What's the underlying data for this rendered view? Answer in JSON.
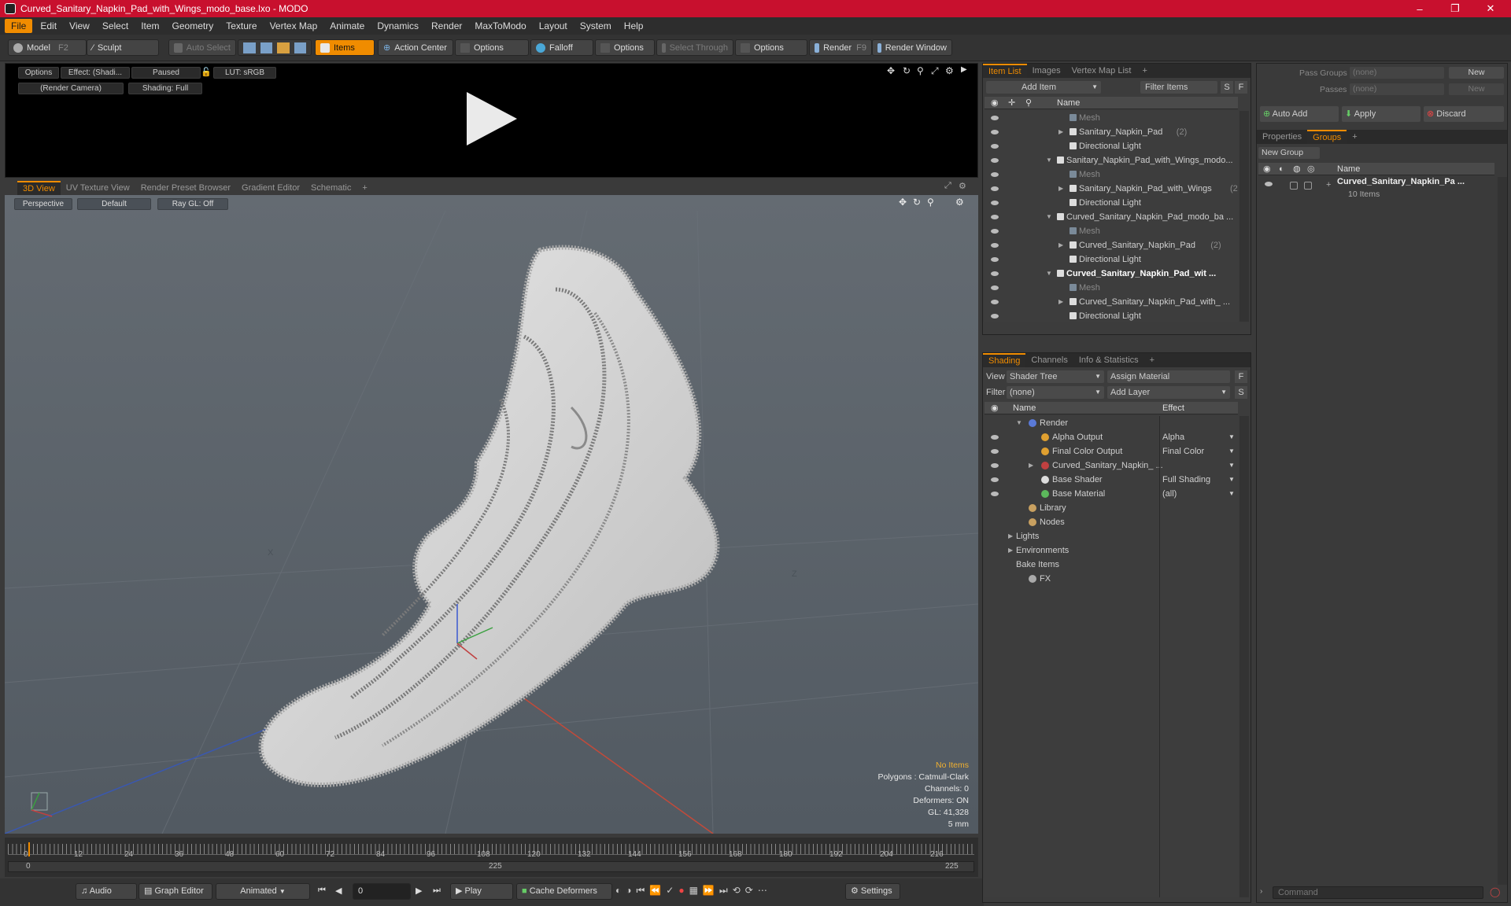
{
  "window": {
    "title": "Curved_Sanitary_Napkin_Pad_with_Wings_modo_base.lxo - MODO"
  },
  "menu": [
    "File",
    "Edit",
    "View",
    "Select",
    "Item",
    "Geometry",
    "Texture",
    "Vertex Map",
    "Animate",
    "Dynamics",
    "Render",
    "MaxToModo",
    "Layout",
    "System",
    "Help"
  ],
  "toolbar": {
    "model": "Model",
    "model_hk": "F2",
    "sculpt": "Sculpt",
    "auto_select": "Auto Select",
    "items": "Items",
    "action_center": "Action Center",
    "options1": "Options",
    "falloff": "Falloff",
    "options2": "Options",
    "select_through": "Select Through",
    "options3": "Options",
    "render": "Render",
    "render_hk": "F9",
    "render_window": "Render Window"
  },
  "preview": {
    "options": "Options",
    "effect": "Effect: (Shadi...",
    "paused": "Paused",
    "lut": "LUT: sRGB",
    "camera": "(Render Camera)",
    "shading": "Shading: Full"
  },
  "viewport_tabs": [
    "3D View",
    "UV Texture View",
    "Render Preset Browser",
    "Gradient Editor",
    "Schematic",
    "+"
  ],
  "viewport": {
    "perspective": "Perspective",
    "default": "Default",
    "raygl": "Ray GL: Off",
    "axis_x": "X",
    "axis_z": "Z"
  },
  "stats": {
    "items": "No Items",
    "polygons": "Polygons : Catmull-Clark",
    "channels": "Channels: 0",
    "deformers": "Deformers: ON",
    "gl": "GL: 41,328",
    "unit": "5 mm"
  },
  "timeline": {
    "ticks": [
      "0",
      "12",
      "24",
      "36",
      "48",
      "60",
      "72",
      "84",
      "96",
      "108",
      "120",
      "132",
      "144",
      "156",
      "168",
      "180",
      "192",
      "204",
      "216"
    ],
    "start": "0",
    "mid": "225",
    "end": "225"
  },
  "bottombar": {
    "audio": "Audio",
    "graph_editor": "Graph Editor",
    "animated": "Animated",
    "frame": "0",
    "play": "Play",
    "cache": "Cache Deformers",
    "settings": "Settings"
  },
  "itemlist": {
    "tabs": [
      "Item List",
      "Images",
      "Vertex Map List",
      "+"
    ],
    "add_item": "Add Item",
    "filter": "Filter Items",
    "s": "S",
    "f": "F",
    "col_name": "Name",
    "rows": [
      {
        "label": "Mesh",
        "indent": 2,
        "dim": true,
        "tri": ""
      },
      {
        "label": "Sanitary_Napkin_Pad",
        "count": "(2)",
        "indent": 2,
        "tri": "▶"
      },
      {
        "label": "Directional Light",
        "indent": 2,
        "tri": ""
      },
      {
        "label": "Sanitary_Napkin_Pad_with_Wings_modo...",
        "indent": 1,
        "tri": "▼"
      },
      {
        "label": "Mesh",
        "indent": 2,
        "dim": true,
        "tri": ""
      },
      {
        "label": "Sanitary_Napkin_Pad_with_Wings",
        "count": "(2)",
        "indent": 2,
        "tri": "▶"
      },
      {
        "label": "Directional Light",
        "indent": 2,
        "tri": ""
      },
      {
        "label": "Curved_Sanitary_Napkin_Pad_modo_ba ...",
        "indent": 1,
        "tri": "▼"
      },
      {
        "label": "Mesh",
        "indent": 2,
        "dim": true,
        "tri": ""
      },
      {
        "label": "Curved_Sanitary_Napkin_Pad",
        "count": "(2)",
        "indent": 2,
        "tri": "▶"
      },
      {
        "label": "Directional Light",
        "indent": 2,
        "tri": ""
      },
      {
        "label": "Curved_Sanitary_Napkin_Pad_wit ...",
        "indent": 1,
        "tri": "▼",
        "bold": true
      },
      {
        "label": "Mesh",
        "indent": 2,
        "dim": true,
        "tri": ""
      },
      {
        "label": "Curved_Sanitary_Napkin_Pad_with_ ...",
        "indent": 2,
        "tri": "▶"
      },
      {
        "label": "Directional Light",
        "indent": 2,
        "tri": ""
      }
    ]
  },
  "shading": {
    "tabs": [
      "Shading",
      "Channels",
      "Info & Statistics",
      "+"
    ],
    "view_label": "View",
    "view_value": "Shader Tree",
    "assign": "Assign Material",
    "f": "F",
    "filter_label": "Filter",
    "filter_value": "(none)",
    "add_layer": "Add Layer",
    "s": "S",
    "col_name": "Name",
    "col_effect": "Effect",
    "rows": [
      {
        "label": "Render",
        "effect": "",
        "indent": 0,
        "tri": "▼",
        "eye": false
      },
      {
        "label": "Alpha Output",
        "effect": "Alpha",
        "indent": 1,
        "tri": "",
        "eye": true
      },
      {
        "label": "Final Color Output",
        "effect": "Final Color",
        "indent": 1,
        "tri": "",
        "eye": true
      },
      {
        "label": "Curved_Sanitary_Napkin_ ...",
        "effect": "",
        "indent": 1,
        "tri": "▶",
        "eye": true
      },
      {
        "label": "Base Shader",
        "effect": "Full Shading",
        "indent": 1,
        "tri": "",
        "eye": true
      },
      {
        "label": "Base Material",
        "effect": "(all)",
        "indent": 1,
        "tri": "",
        "eye": true
      },
      {
        "label": "Library",
        "effect": "",
        "indent": 0,
        "tri": "",
        "eye": false
      },
      {
        "label": "Nodes",
        "effect": "",
        "indent": 0,
        "tri": "",
        "eye": false
      },
      {
        "label": "Lights",
        "effect": "",
        "indent": -1,
        "tri": "▶",
        "eye": false
      },
      {
        "label": "Environments",
        "effect": "",
        "indent": -1,
        "tri": "▶",
        "eye": false
      },
      {
        "label": "Bake Items",
        "effect": "",
        "indent": -1,
        "tri": "",
        "eye": false
      },
      {
        "label": "FX",
        "effect": "",
        "indent": 0,
        "tri": "",
        "eye": false
      }
    ]
  },
  "groups": {
    "pass_groups": "Pass Groups",
    "passes": "Passes",
    "none": "(none)",
    "new": "New",
    "auto_add": "Auto Add",
    "apply": "Apply",
    "discard": "Discard",
    "tabs": [
      "Properties",
      "Groups",
      "+"
    ],
    "new_group": "New Group",
    "col_name": "Name",
    "item_name": "Curved_Sanitary_Napkin_Pa ...",
    "item_count": "10 Items"
  },
  "command": {
    "placeholder": "Command"
  }
}
